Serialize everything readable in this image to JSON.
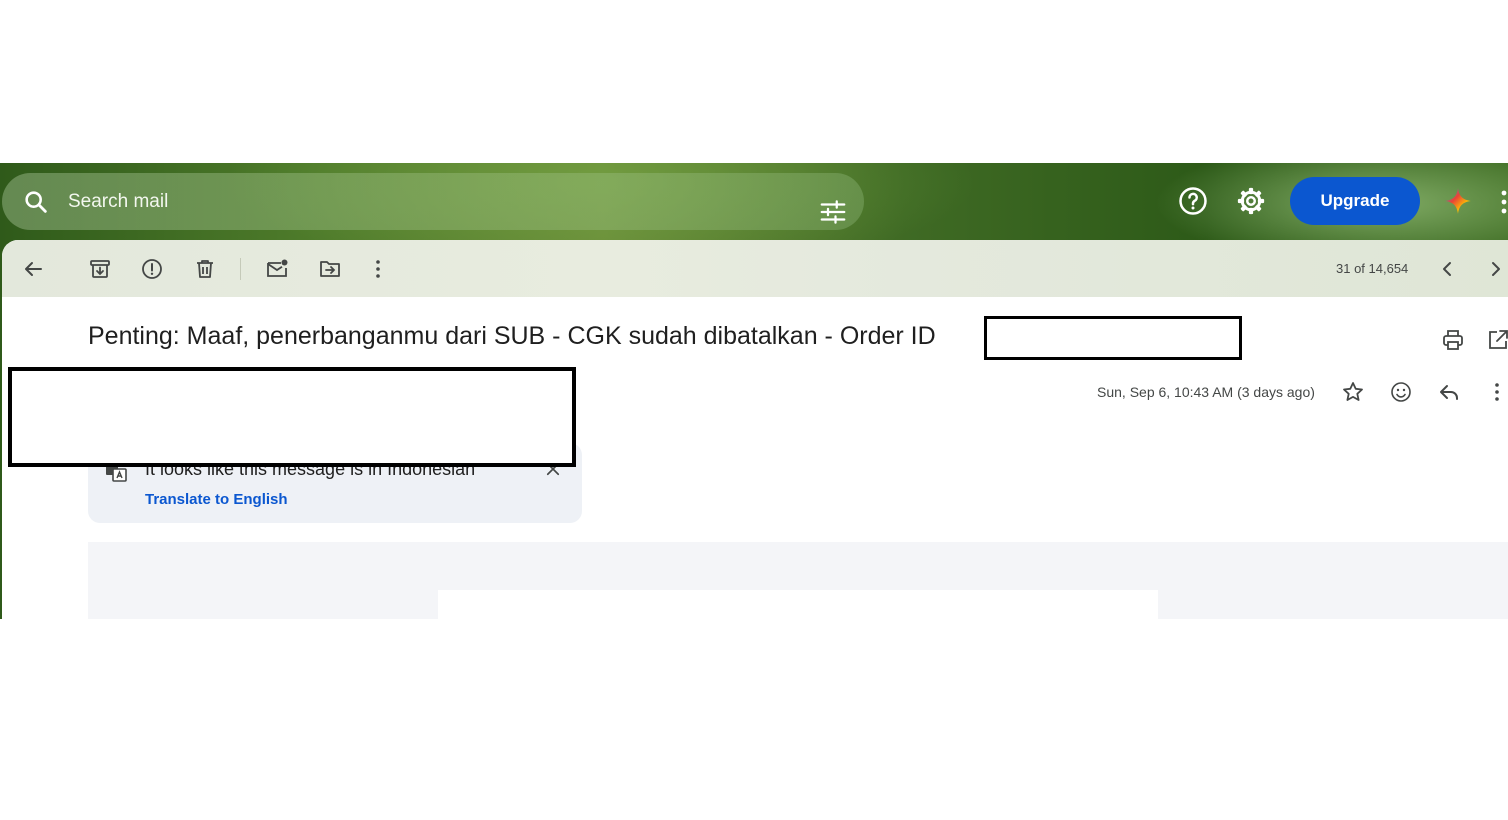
{
  "search": {
    "placeholder": "Search mail"
  },
  "header": {
    "upgrade_label": "Upgrade"
  },
  "toolbar": {
    "count": "31 of 14,654"
  },
  "email": {
    "subject": "Penting: Maaf, penerbanganmu dari SUB - CGK sudah dibatalkan - Order ID",
    "date": "Sun, Sep 6, 10:43 AM (3 days ago)"
  },
  "translate": {
    "message": "It looks like this message is in Indonesian",
    "link": "Translate to English"
  },
  "colors": {
    "accent": "#0b57d0",
    "upgrade_bg": "#0b57d0",
    "banner_green": "#3f6a24"
  },
  "icons": {
    "search": "search-icon",
    "tune": "tune-icon",
    "help": "help-icon",
    "settings": "gear-icon",
    "gemini": "gemini-icon",
    "apps": "apps-icon",
    "back": "back-arrow-icon",
    "archive": "archive-icon",
    "spam": "report-spam-icon",
    "delete": "trash-icon",
    "mark_unread": "mark-unread-icon",
    "move": "move-to-icon",
    "more": "more-vert-icon",
    "prev": "chevron-left-icon",
    "next": "chevron-right-icon",
    "print": "print-icon",
    "new_window": "open-in-new-icon",
    "star": "star-icon",
    "emoji": "emoji-icon",
    "reply": "reply-icon",
    "translate": "translate-icon",
    "close": "close-icon"
  }
}
